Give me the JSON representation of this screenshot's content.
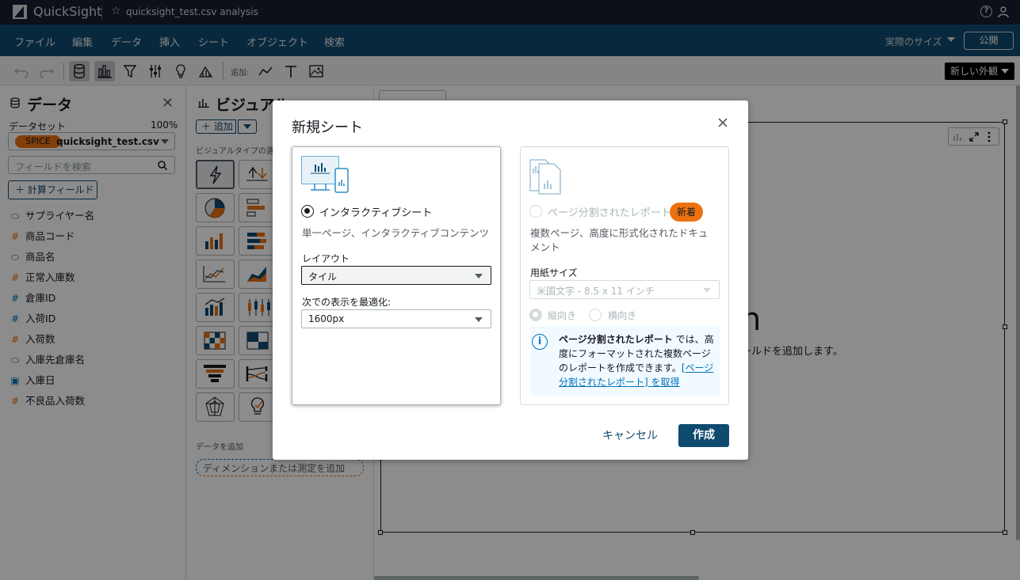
{
  "app": {
    "brand": "QuickSight",
    "analysis_title": "quicksight_test.csv analysis"
  },
  "menubar": {
    "items": [
      "ファイル",
      "編集",
      "データ",
      "挿入",
      "シート",
      "オブジェクト",
      "検索"
    ],
    "size_label": "実際のサイズ",
    "publish_label": "公開"
  },
  "toolbar": {
    "add_label": "追加:",
    "new_look_label": "新しい外観"
  },
  "data_panel": {
    "title": "データ",
    "dataset_label": "データセット",
    "dataset_percent": "100%",
    "spice_badge": "SPICE",
    "dataset_name": "quicksight_test.csv",
    "search_placeholder": "フィールドを検索",
    "calc_field_label": "計算フィールド",
    "fields": [
      {
        "name": "サプライヤー名",
        "type": "dimension",
        "icon": "tag-icon"
      },
      {
        "name": "商品コード",
        "type": "measure",
        "icon": "hash-icon"
      },
      {
        "name": "商品名",
        "type": "dimension",
        "icon": "tag-icon"
      },
      {
        "name": "正常入庫数",
        "type": "measure",
        "icon": "hash-icon"
      },
      {
        "name": "倉庫ID",
        "type": "measure-blue",
        "icon": "hash-icon"
      },
      {
        "name": "入荷ID",
        "type": "measure-blue",
        "icon": "hash-icon"
      },
      {
        "name": "入荷数",
        "type": "measure",
        "icon": "hash-icon"
      },
      {
        "name": "入庫先倉庫名",
        "type": "dimension",
        "icon": "tag-icon"
      },
      {
        "name": "入庫日",
        "type": "date",
        "icon": "calendar-icon"
      },
      {
        "name": "不良品入荷数",
        "type": "measure",
        "icon": "hash-icon"
      }
    ]
  },
  "visual_panel": {
    "title": "ビジュアル",
    "add_label": "追加",
    "visual_types_label": "ビジュアルタイプの選",
    "data_add_label": "データを追加",
    "dropzone_label": "ディメンションまたは測定を追加"
  },
  "canvas": {
    "big_text": "n",
    "hint": "ールドを追加します。"
  },
  "dialog": {
    "title": "新規シート",
    "interactive": {
      "label": "インタラクティブシート",
      "description": "単一ページ、インタラクティブコンテンツ",
      "layout_label": "レイアウト",
      "layout_value": "タイル",
      "optimize_label": "次での表示を最適化:",
      "optimize_value": "1600px",
      "selected": true
    },
    "paginated": {
      "label": "ページ分割されたレポート",
      "new_badge": "新着",
      "description_line1": "複数ページ、高度に形式化されたドキュ",
      "description_line2": "メント",
      "paper_label": "用紙サイズ",
      "paper_value": "米国文字 - 8.5 x 11 インチ",
      "portrait_label": "縦向き",
      "landscape_label": "横向き",
      "info_bold": "ページ分割されたレポート",
      "info_text": " では、高度にフォーマットされた複数ページのレポートを作成できます。",
      "info_link": "[ページ分割されたレポート] を取得",
      "selected": false
    },
    "cancel_label": "キャンセル",
    "create_label": "作成"
  },
  "colors": {
    "topbar": "#161e2d",
    "menubar": "#0f4a6f",
    "accent_orange": "#ec7211",
    "primary_button": "#0f4a6f",
    "link": "#0073bb"
  }
}
